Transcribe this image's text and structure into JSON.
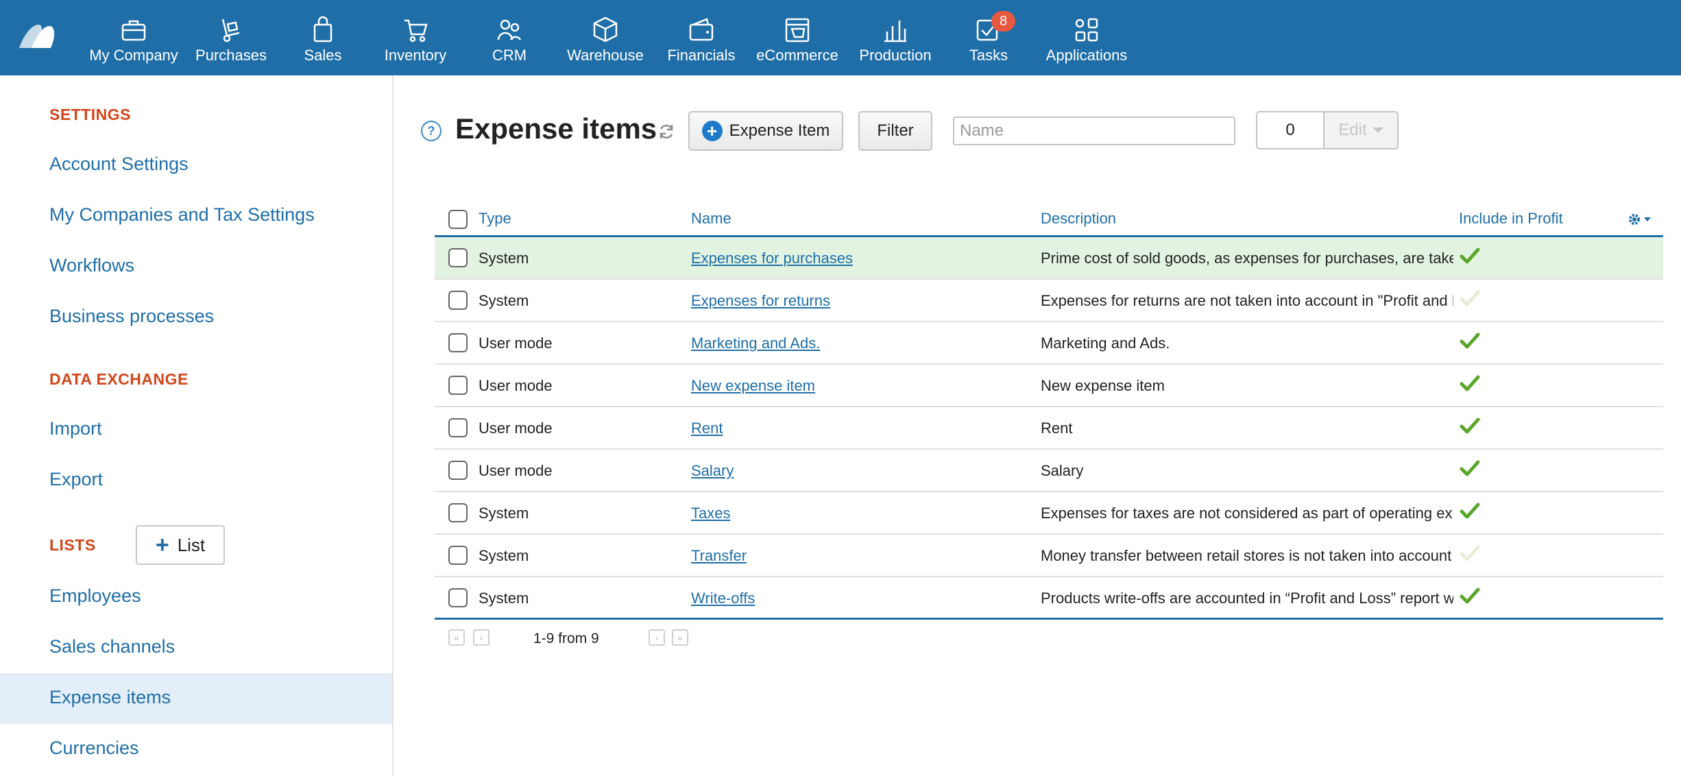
{
  "nav": {
    "items": [
      {
        "label": "My Company",
        "icon": "briefcase-icon"
      },
      {
        "label": "Purchases",
        "icon": "hand-truck-icon"
      },
      {
        "label": "Sales",
        "icon": "shopping-bag-icon"
      },
      {
        "label": "Inventory",
        "icon": "cart-icon"
      },
      {
        "label": "CRM",
        "icon": "people-icon"
      },
      {
        "label": "Warehouse",
        "icon": "box-icon"
      },
      {
        "label": "Financials",
        "icon": "wallet-icon"
      },
      {
        "label": "eCommerce",
        "icon": "storefront-icon"
      },
      {
        "label": "Production",
        "icon": "factory-icon"
      },
      {
        "label": "Tasks",
        "icon": "checkbox-icon",
        "badge": "8"
      },
      {
        "label": "Applications",
        "icon": "apps-grid-icon"
      }
    ],
    "colors": {
      "background": "#1f6ea8",
      "badge": "#e8573f"
    }
  },
  "sidebar": {
    "settings_header": "SETTINGS",
    "settings_items": [
      "Account Settings",
      "My Companies and Tax Settings",
      "Workflows",
      "Business processes"
    ],
    "data_exchange_header": "DATA EXCHANGE",
    "data_exchange_items": [
      "Import",
      "Export"
    ],
    "lists_header": "LISTS",
    "list_button_label": "List",
    "lists_items": [
      "Employees",
      "Sales channels",
      "Expense items",
      "Currencies"
    ],
    "active_item": "Expense items"
  },
  "header": {
    "title": "Expense items",
    "help_icon": "?",
    "add_button_label": "Expense Item",
    "filter_button_label": "Filter",
    "search_placeholder": "Name",
    "selected_count": "0",
    "edit_label": "Edit"
  },
  "table": {
    "columns": [
      "Type",
      "Name",
      "Description",
      "Include in Profit"
    ],
    "rows": [
      {
        "type": "System",
        "name": "Expenses for purchases",
        "description": "Prime cost of sold goods, as expenses for purchases, are taken into account in \"Profit and Loss\" report",
        "include": true,
        "highlight": true
      },
      {
        "type": "System",
        "name": "Expenses for returns",
        "description": "Expenses for returns are not taken into account in \"Profit and Loss\" report",
        "include": false
      },
      {
        "type": "User mode",
        "name": "Marketing and Ads.",
        "description": "Marketing and Ads.",
        "include": true
      },
      {
        "type": "User mode",
        "name": "New expense item",
        "description": "New expense item",
        "include": true
      },
      {
        "type": "User mode",
        "name": "Rent",
        "description": "Rent",
        "include": true
      },
      {
        "type": "User mode",
        "name": "Salary",
        "description": "Salary",
        "include": true
      },
      {
        "type": "System",
        "name": "Taxes",
        "description": "Expenses for taxes are not considered as part of operating expenses",
        "include": true
      },
      {
        "type": "System",
        "name": "Transfer",
        "description": "Money transfer between retail stores is not taken into account",
        "include": false
      },
      {
        "type": "System",
        "name": "Write-offs",
        "description": "Products write-offs are accounted in “Profit and Loss” report with expenses",
        "include": true
      }
    ],
    "check_colors": {
      "on": "#5aa62a",
      "off": "#e6eed9"
    }
  },
  "pagination": {
    "text": "1-9 from 9"
  }
}
